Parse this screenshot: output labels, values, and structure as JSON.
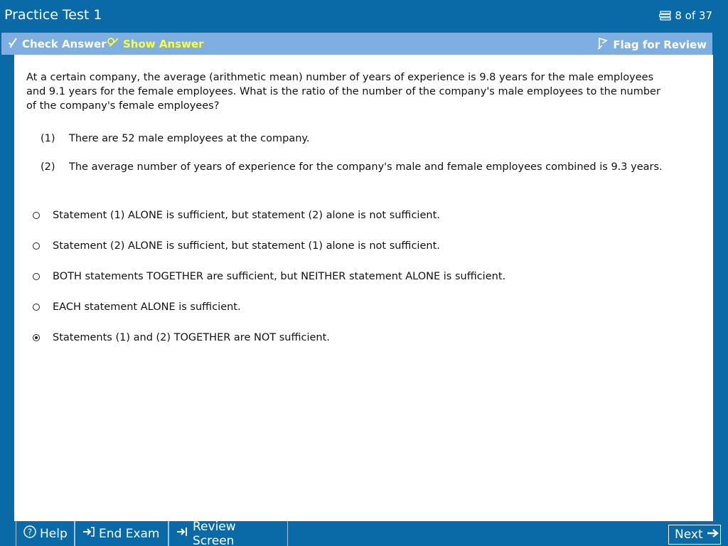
{
  "header": {
    "title": "Practice Test 1",
    "progress": "8 of 37",
    "progress_icon": "list-icon"
  },
  "toolbar": {
    "check_answer": "Check Answer",
    "show_answer": "Show Answer",
    "flag_for_review": "Flag for Review"
  },
  "question": {
    "stem": "At a certain company, the average (arithmetic mean) number of years of experience is 9.8 years for the male employees and 9.1 years for the female employees.  What is the ratio of the number of the company's male employees to the number of the company's female employees?",
    "statements": [
      {
        "num": "(1)",
        "text": "There are 52 male employees at the company."
      },
      {
        "num": "(2)",
        "text": "The average number of years of experience for the company's male and female employees combined is 9.3 years."
      }
    ],
    "choices": [
      {
        "text": "Statement (1) ALONE is sufficient, but statement (2) alone is not sufficient.",
        "selected": false
      },
      {
        "text": "Statement (2) ALONE is sufficient, but statement (1) alone is not sufficient.",
        "selected": false
      },
      {
        "text": "BOTH statements TOGETHER are sufficient, but NEITHER statement ALONE is sufficient.",
        "selected": false
      },
      {
        "text": "EACH statement ALONE is sufficient.",
        "selected": false
      },
      {
        "text": "Statements (1) and (2) TOGETHER are NOT sufficient.",
        "selected": true
      }
    ]
  },
  "footer": {
    "help": "Help",
    "end_exam": "End Exam",
    "review_screen": "Review Screen",
    "next": "Next"
  },
  "colors": {
    "frame": "#0a6aa8",
    "toolbar": "#7faee0",
    "show_answer": "#ffff33"
  }
}
